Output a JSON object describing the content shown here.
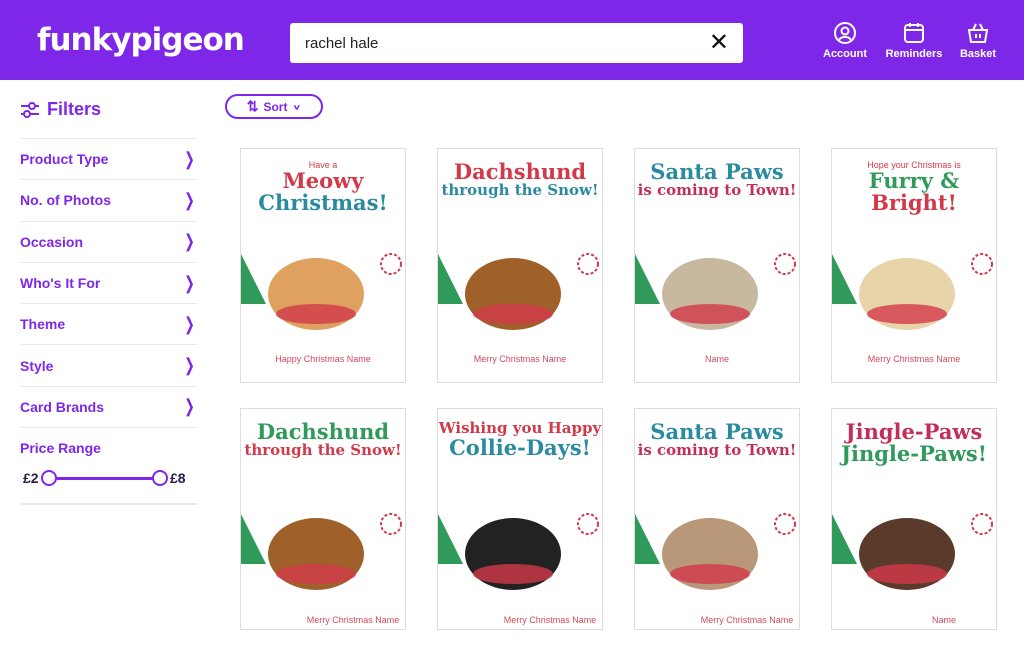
{
  "header": {
    "logo": "funkypigeon",
    "search_value": "rachel hale",
    "account": "Account",
    "reminders": "Reminders",
    "basket": "Basket"
  },
  "colors": {
    "brand": "#7f27e8",
    "card_text": "#d24a5a"
  },
  "sidebar": {
    "title": "Filters",
    "items": [
      {
        "label": "Product Type"
      },
      {
        "label": "No. of Photos"
      },
      {
        "label": "Occasion"
      },
      {
        "label": "Who's It For"
      },
      {
        "label": "Theme"
      },
      {
        "label": "Style"
      },
      {
        "label": "Card Brands"
      }
    ],
    "price": {
      "label": "Price Range",
      "min": "£2",
      "max": "£8"
    }
  },
  "sort": {
    "label": "Sort"
  },
  "cards": [
    {
      "lines": [
        {
          "text": "Have a",
          "size": "small"
        },
        {
          "text": "Meowy",
          "size": "big"
        },
        {
          "text": "Christmas!",
          "size": "big"
        }
      ],
      "footer": "Happy Christmas Name",
      "animal": "#e0a060"
    },
    {
      "lines": [
        {
          "text": "Dachshund",
          "size": "big"
        },
        {
          "text": "through the Snow!",
          "size": "big"
        }
      ],
      "footer": "Merry Christmas Name",
      "animal": "#a0602a"
    },
    {
      "lines": [
        {
          "text": "Santa Paws",
          "size": "big"
        },
        {
          "text": "is coming to Town!",
          "size": "big"
        }
      ],
      "footer": "Name",
      "animal": "#c8b8a0"
    },
    {
      "lines": [
        {
          "text": "Hope your Christmas is",
          "size": "small"
        },
        {
          "text": "Furry &",
          "size": "big"
        },
        {
          "text": "Bright!",
          "size": "big"
        }
      ],
      "footer": "Merry Christmas Name",
      "animal": "#e8d4a8"
    },
    {
      "lines": [
        {
          "text": "Dachshund",
          "size": "big"
        },
        {
          "text": "through the Snow!",
          "size": "big"
        }
      ],
      "footer": "Merry Christmas Name",
      "animal": "#a0602a"
    },
    {
      "lines": [
        {
          "text": "Wishing you Happy",
          "size": "big"
        },
        {
          "text": "Collie-Days!",
          "size": "big"
        }
      ],
      "footer": "Merry Christmas Name",
      "animal": "#222222"
    },
    {
      "lines": [
        {
          "text": "Santa Paws",
          "size": "big"
        },
        {
          "text": "is coming to Town!",
          "size": "big"
        }
      ],
      "footer": "Merry Christmas Name",
      "animal": "#b89878"
    },
    {
      "lines": [
        {
          "text": "Jingle-Paws",
          "size": "big"
        },
        {
          "text": "Jingle-Paws!",
          "size": "big"
        }
      ],
      "footer": "Name",
      "animal": "#5a3a2a"
    }
  ]
}
